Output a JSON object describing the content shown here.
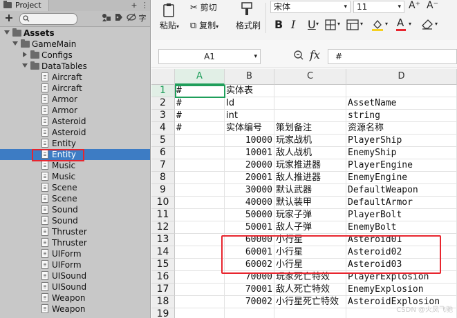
{
  "project_panel": {
    "tab_label": "Project",
    "header_buttons": [
      "+",
      "⋮"
    ],
    "toolbar_icons": [
      "create-icon",
      "search-icon",
      "filter-icon",
      "label-icon",
      "hidden-icon"
    ],
    "toolbar_label": "字",
    "tree": [
      {
        "label": "Assets",
        "kind": "folder",
        "depth": 0,
        "expanded": true
      },
      {
        "label": "GameMain",
        "kind": "folder",
        "depth": 1,
        "expanded": true
      },
      {
        "label": "Configs",
        "kind": "folder",
        "depth": 2,
        "expanded": false
      },
      {
        "label": "DataTables",
        "kind": "folder",
        "depth": 2,
        "expanded": true
      },
      {
        "label": "Aircraft",
        "kind": "file",
        "depth": 3
      },
      {
        "label": "Aircraft",
        "kind": "file",
        "depth": 3
      },
      {
        "label": "Armor",
        "kind": "file",
        "depth": 3
      },
      {
        "label": "Armor",
        "kind": "file",
        "depth": 3
      },
      {
        "label": "Asteroid",
        "kind": "file",
        "depth": 3
      },
      {
        "label": "Asteroid",
        "kind": "file",
        "depth": 3
      },
      {
        "label": "Entity",
        "kind": "file",
        "depth": 3
      },
      {
        "label": "Entity",
        "kind": "file",
        "depth": 3,
        "selected": true
      },
      {
        "label": "Music",
        "kind": "file",
        "depth": 3
      },
      {
        "label": "Music",
        "kind": "file",
        "depth": 3
      },
      {
        "label": "Scene",
        "kind": "file",
        "depth": 3
      },
      {
        "label": "Scene",
        "kind": "file",
        "depth": 3
      },
      {
        "label": "Sound",
        "kind": "file",
        "depth": 3
      },
      {
        "label": "Sound",
        "kind": "file",
        "depth": 3
      },
      {
        "label": "Thruster",
        "kind": "file",
        "depth": 3
      },
      {
        "label": "Thruster",
        "kind": "file",
        "depth": 3
      },
      {
        "label": "UIForm",
        "kind": "file",
        "depth": 3
      },
      {
        "label": "UIForm",
        "kind": "file",
        "depth": 3
      },
      {
        "label": "UISound",
        "kind": "file",
        "depth": 3
      },
      {
        "label": "UISound",
        "kind": "file",
        "depth": 3
      },
      {
        "label": "Weapon",
        "kind": "file",
        "depth": 3
      },
      {
        "label": "Weapon",
        "kind": "file",
        "depth": 3
      }
    ]
  },
  "ribbon": {
    "cut_label": "剪切",
    "paste_label": "粘贴",
    "copy_label": "复制",
    "format_painter_label": "格式刷",
    "font_name": "宋体",
    "font_size": "11",
    "bold": "B",
    "italic": "I",
    "underline": "U",
    "increase_font": "A⁺",
    "decrease_font": "A⁻",
    "font_color_letter": "A"
  },
  "formula_bar": {
    "name_box": "A1",
    "fx_label": "fx",
    "content": "#"
  },
  "sheet": {
    "columns": [
      "A",
      "B",
      "C",
      "D"
    ],
    "rows": [
      {
        "n": "1",
        "a": "#",
        "b": "实体表",
        "c": "",
        "d": ""
      },
      {
        "n": "2",
        "a": "#",
        "b": "Id",
        "c": "",
        "d": "AssetName"
      },
      {
        "n": "3",
        "a": "#",
        "b": "int",
        "c": "",
        "d": "string"
      },
      {
        "n": "4",
        "a": "#",
        "b": "实体编号",
        "c": "策划备注",
        "d": "资源名称"
      },
      {
        "n": "5",
        "a": "",
        "b": "10000",
        "c": "玩家战机",
        "d": "PlayerShip"
      },
      {
        "n": "6",
        "a": "",
        "b": "10001",
        "c": "敌人战机",
        "d": "EnemyShip"
      },
      {
        "n": "7",
        "a": "",
        "b": "20000",
        "c": "玩家推进器",
        "d": "PlayerEngine"
      },
      {
        "n": "8",
        "a": "",
        "b": "20001",
        "c": "敌人推进器",
        "d": "EnemyEngine"
      },
      {
        "n": "9",
        "a": "",
        "b": "30000",
        "c": "默认武器",
        "d": "DefaultWeapon"
      },
      {
        "n": "10",
        "a": "",
        "b": "40000",
        "c": "默认装甲",
        "d": "DefaultArmor"
      },
      {
        "n": "11",
        "a": "",
        "b": "50000",
        "c": "玩家子弹",
        "d": "PlayerBolt"
      },
      {
        "n": "12",
        "a": "",
        "b": "50001",
        "c": "敌人子弹",
        "d": "EnemyBolt"
      },
      {
        "n": "13",
        "a": "",
        "b": "60000",
        "c": "小行星",
        "d": "Asteroid01"
      },
      {
        "n": "14",
        "a": "",
        "b": "60001",
        "c": "小行星",
        "d": "Asteroid02"
      },
      {
        "n": "15",
        "a": "",
        "b": "60002",
        "c": "小行星",
        "d": "Asteroid03"
      },
      {
        "n": "16",
        "a": "",
        "b": "70000",
        "c": "玩家死亡特效",
        "d": "PlayerExplosion"
      },
      {
        "n": "17",
        "a": "",
        "b": "70001",
        "c": "敌人死亡特效",
        "d": "EnemyExplosion"
      },
      {
        "n": "18",
        "a": "",
        "b": "70002",
        "c": "小行星死亡特效",
        "d": "AsteroidExplosion"
      },
      {
        "n": "19",
        "a": "",
        "b": "",
        "c": "",
        "d": ""
      }
    ]
  },
  "watermark": "CSDN @火凤飞驰",
  "colors": {
    "selection_blue": "#3d7cc4",
    "highlight_red": "#e8252e",
    "active_cell_green": "#1e9e5a"
  }
}
